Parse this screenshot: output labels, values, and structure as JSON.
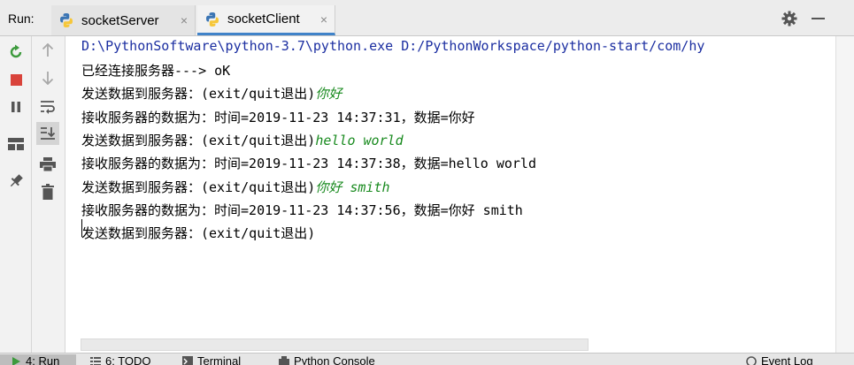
{
  "run_panel": {
    "label": "Run:",
    "tabs": [
      {
        "label": "socketServer",
        "close": "×"
      },
      {
        "label": "socketClient",
        "close": "×"
      }
    ]
  },
  "console": {
    "lines": [
      "D:\\PythonSoftware\\python-3.7\\python.exe D:/PythonWorkspace/python-start/com/hy",
      "已经连接服务器---> oK",
      "发送数据到服务器：(exit/quit退出)",
      "你好",
      "接收服务器的数据为：时间=2019-11-23 14:37:31，数据=你好",
      "发送数据到服务器：(exit/quit退出)",
      "hello world",
      "接收服务器的数据为：时间=2019-11-23 14:37:38，数据=hello world",
      "发送数据到服务器：(exit/quit退出)",
      "你好 smith",
      "接收服务器的数据为：时间=2019-11-23 14:37:56，数据=你好 smith",
      "发送数据到服务器：(exit/quit退出)"
    ]
  },
  "bottom_tabs": [
    "4: Run",
    "6: TODO",
    "Terminal",
    "Python Console",
    "Event Log"
  ],
  "colors": {
    "command": "#1b2ea1",
    "user_input": "#188a1e",
    "rerun": "#3c9a3c",
    "stop": "#d9433b",
    "active_tab_underline": "#4083c9"
  },
  "icons": {
    "toolbar_left": [
      "rerun-icon",
      "stop-icon",
      "pause-icon",
      "layout-icon",
      "pin-icon"
    ],
    "toolbar_second": [
      "up-arrow-icon",
      "down-arrow-icon",
      "soft-wrap-icon",
      "scroll-to-end-icon",
      "print-icon",
      "trash-icon"
    ],
    "header": [
      "gear-icon",
      "minimize-icon"
    ]
  }
}
